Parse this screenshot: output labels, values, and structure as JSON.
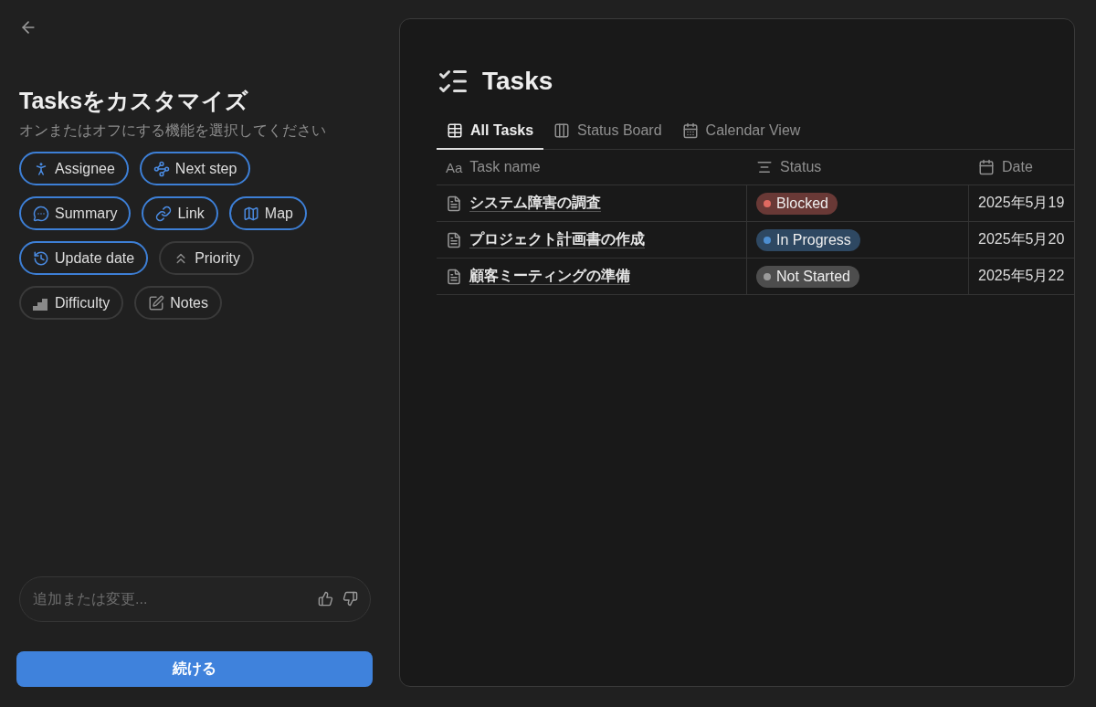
{
  "left_panel": {
    "title": "Tasksをカスタマイズ",
    "subtitle": "オンまたはオフにする機能を選択してください",
    "features": [
      {
        "label": "Assignee",
        "selected": true
      },
      {
        "label": "Next step",
        "selected": true
      },
      {
        "label": "Summary",
        "selected": true
      },
      {
        "label": "Link",
        "selected": true
      },
      {
        "label": "Map",
        "selected": true
      },
      {
        "label": "Update date",
        "selected": true
      },
      {
        "label": "Priority",
        "selected": false
      },
      {
        "label": "Difficulty",
        "selected": false
      },
      {
        "label": "Notes",
        "selected": false
      }
    ],
    "input": {
      "placeholder": "追加または変更..."
    },
    "continue_button": "続ける"
  },
  "preview": {
    "title": "Tasks",
    "tabs": [
      {
        "label": "All Tasks",
        "selected": true
      },
      {
        "label": "Status Board",
        "selected": false
      },
      {
        "label": "Calendar View",
        "selected": false
      }
    ],
    "columns": [
      "Task name",
      "Status",
      "Date"
    ],
    "name_column_icon": "Aa",
    "rows": [
      {
        "name": "システム障害の調査",
        "status": "Blocked",
        "color": "#e06a61",
        "date": "2025年5月19"
      },
      {
        "name": "プロジェクト計画書の作成",
        "status": "In Progress",
        "color": "#4d8ed0",
        "date": "2025年5月20"
      },
      {
        "name": "顧客ミーティングの準備",
        "status": "Not Started",
        "color": "#9b9b9b",
        "date": "2025年5月22"
      }
    ]
  }
}
